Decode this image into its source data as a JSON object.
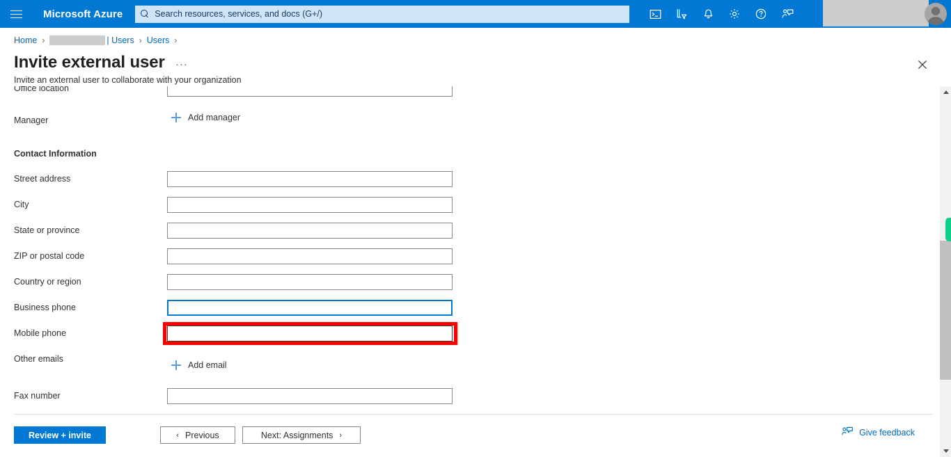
{
  "topbar": {
    "menu_icon": "hamburger-icon",
    "brand": "Microsoft Azure",
    "search_placeholder": "Search resources, services, and docs (G+/)",
    "icons": [
      {
        "name": "cloud-shell-icon",
        "label": "Cloud Shell"
      },
      {
        "name": "directory-filter-icon",
        "label": "Directories + subscriptions"
      },
      {
        "name": "notifications-bell-icon",
        "label": "Notifications"
      },
      {
        "name": "settings-gear-icon",
        "label": "Settings"
      },
      {
        "name": "help-question-icon",
        "label": "Help"
      },
      {
        "name": "feedback-icon",
        "label": "Feedback"
      }
    ],
    "avatar_label": "Account",
    "accent_color": "#0078d4",
    "search_bg_color": "#cfe4f7"
  },
  "breadcrumb": {
    "items": [
      {
        "label": "Home",
        "type": "link"
      },
      {
        "label": "",
        "type": "redacted"
      },
      {
        "label": "| Users",
        "type": "link"
      },
      {
        "label": "Users",
        "type": "link"
      }
    ],
    "separator": "›"
  },
  "header": {
    "title": "Invite external user",
    "ellipsis": "···",
    "subtitle": "Invite an external user to collaborate with your organization",
    "close_label": "Close"
  },
  "form": {
    "clipped_field": {
      "label": "Office location",
      "value": ""
    },
    "manager": {
      "label": "Manager",
      "action": "Add manager"
    },
    "section_title": "Contact Information",
    "fields": [
      {
        "label": "Street address",
        "value": "",
        "state": "normal"
      },
      {
        "label": "City",
        "value": "",
        "state": "normal"
      },
      {
        "label": "State or province",
        "value": "",
        "state": "normal"
      },
      {
        "label": "ZIP or postal code",
        "value": "",
        "state": "normal"
      },
      {
        "label": "Country or region",
        "value": "",
        "state": "normal"
      },
      {
        "label": "Business phone",
        "value": "",
        "state": "focused"
      },
      {
        "label": "Mobile phone",
        "value": "",
        "state": "annotated"
      }
    ],
    "other_emails": {
      "label": "Other emails",
      "action": "Add email"
    },
    "fax": {
      "label": "Fax number",
      "value": ""
    },
    "annotation_color": "#ff0000",
    "focus_color": "#0078d4"
  },
  "footer": {
    "primary_button": "Review + invite",
    "previous_button": "Previous",
    "next_button": "Next: Assignments",
    "prev_chevron": "‹",
    "next_chevron": "›",
    "feedback_link": "Give feedback"
  },
  "scrollbar": {
    "up_arrow": "scroll-up-arrow",
    "down_arrow": "scroll-down-arrow",
    "thumb": "scroll-thumb",
    "indicator_color": "#0bd18a"
  }
}
